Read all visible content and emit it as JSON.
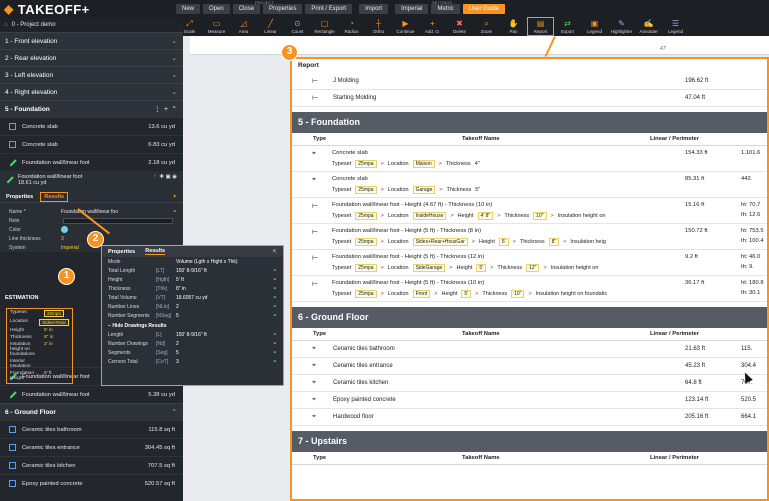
{
  "app": {
    "name": "TAKEOFF+"
  },
  "menu": {
    "project_label": "PROJECT",
    "settings_label": "SETTINGS",
    "buttons": [
      "New",
      "Open",
      "Close",
      "Properties",
      "Print / Export",
      "Import",
      "Imperial",
      "Metric",
      "User Guide"
    ]
  },
  "tools": [
    {
      "label": "Scale",
      "icon": "scale-icon"
    },
    {
      "label": "Measure",
      "icon": "measure-icon"
    },
    {
      "label": "Area",
      "icon": "area-icon"
    },
    {
      "label": "Linear",
      "icon": "linear-icon"
    },
    {
      "label": "Count",
      "icon": "count-icon"
    },
    {
      "label": "Rectangle",
      "icon": "rectangle-icon"
    },
    {
      "label": "Radius",
      "icon": "radius-icon"
    },
    {
      "label": "Ortho",
      "icon": "ortho-icon"
    },
    {
      "label": "Continue",
      "icon": "continue-icon"
    },
    {
      "label": "Add. O.",
      "icon": "add-icon"
    },
    {
      "label": "Delete",
      "icon": "delete-icon"
    },
    {
      "label": "Zoom",
      "icon": "zoom-icon"
    },
    {
      "label": "Pan",
      "icon": "pan-icon"
    },
    {
      "label": "Report",
      "icon": "report-icon"
    },
    {
      "label": "Export",
      "icon": "export-icon"
    },
    {
      "label": "Legend",
      "icon": "legend-icon"
    },
    {
      "label": "Highlighter",
      "icon": "highlighter-icon"
    },
    {
      "label": "Annotate",
      "icon": "annotate-icon"
    },
    {
      "label": "Legend",
      "icon": "legend-icon"
    }
  ],
  "sidebar": {
    "project": "0 - Project demo",
    "sections": [
      {
        "label": "1 - Front elevation"
      },
      {
        "label": "2 - Rear elevation"
      },
      {
        "label": "3 - Left elevation"
      },
      {
        "label": "4 - Right elevation"
      }
    ],
    "foundation": {
      "label": "5 - Foundation",
      "items": [
        {
          "name": "Concrete slab",
          "value": "13.6 cu yd"
        },
        {
          "name": "Concrete slab",
          "value": "6.83 cu yd"
        },
        {
          "name": "Foundation wall/linear foot",
          "value": "2.18 cu yd"
        }
      ],
      "selected": {
        "name": "Foundation wall/linear foot",
        "value": "18.61 cu yd"
      }
    },
    "tabs": {
      "properties": "Properties",
      "results": "Results"
    },
    "props": [
      {
        "k": "Name *",
        "v": "Foundation wall/linear foo"
      },
      {
        "k": "Note",
        "v": ""
      },
      {
        "k": "Color",
        "v": ""
      },
      {
        "k": "Line thickness",
        "v": "3"
      },
      {
        "k": "System",
        "v": "Imperial"
      }
    ],
    "estimation": {
      "title": "ESTIMATION",
      "rows": [
        {
          "k": "Typeset",
          "v": "25mpa"
        },
        {
          "k": "Location",
          "v": "Sides+Rear"
        },
        {
          "k": "Height",
          "v": "5' in"
        },
        {
          "k": "Thickness",
          "v": "8\" in"
        },
        {
          "k": "Insulation height on foundations",
          "v": "2' in"
        },
        {
          "k": "Interior Insulation",
          "v": ""
        },
        {
          "k": "Foundation Height",
          "v": "5' ft"
        }
      ]
    },
    "after": [
      {
        "name": "Foundation wall/linear foot",
        "value": ""
      },
      {
        "name": "Foundation wall/linear foot",
        "value": "5.38 cu yd"
      }
    ],
    "ground": {
      "label": "6 - Ground Floor",
      "items": [
        {
          "name": "Ceramic tiles bathroom",
          "value": "115.8 sq ft"
        },
        {
          "name": "Ceramic tiles entrance",
          "value": "304.45 sq ft"
        },
        {
          "name": "Ceramic tiles kitchen",
          "value": "707.5 sq ft"
        },
        {
          "name": "Epoxy painted concrete",
          "value": "520.57 sq ft"
        }
      ]
    }
  },
  "popup": {
    "tabs": [
      "Properties",
      "Results"
    ],
    "rows": [
      {
        "k": "Mode",
        "u": "",
        "v": "Volume (Lgth x Hight x Thk)"
      },
      {
        "k": "Total Length",
        "u": "[LT]",
        "v": "150' 8-9/16\" ft"
      },
      {
        "k": "Height",
        "u": "[Hgth]",
        "v": "5' ft"
      },
      {
        "k": "Thickness",
        "u": "[Thk]",
        "v": "8\" in"
      },
      {
        "k": "Total Volume",
        "u": "[VT]",
        "v": "18.6057 cu yd"
      },
      {
        "k": "Number Lines",
        "u": "[NLin]",
        "v": "2"
      },
      {
        "k": "Number Segments",
        "u": "[NSeg]",
        "v": "5"
      }
    ],
    "sub": "Hide Drawings Results",
    "rows2": [
      {
        "k": "Length",
        "u": "[L]",
        "v": "150' 8-9/16\" ft"
      },
      {
        "k": "Number Drawings",
        "u": "[Nd]",
        "v": "2"
      },
      {
        "k": "Segments",
        "u": "[Seg]",
        "v": "5"
      },
      {
        "k": "Corners Total",
        "u": "[CoT]",
        "v": "3"
      }
    ]
  },
  "ruler": {
    "label": "47'"
  },
  "report": {
    "title": "Report",
    "top_rows": [
      {
        "name": "J Molding",
        "linear": "196.62 ft",
        "ext": ""
      },
      {
        "name": "Starting Molding",
        "linear": "47.04 ft",
        "ext": ""
      }
    ],
    "headers": {
      "type": "Type",
      "name": "Takeoff Name",
      "linear": "Linear / Perimeter"
    },
    "foundation": {
      "title": "5 - Foundation",
      "rows": [
        {
          "name": "Concrete slab",
          "path": [
            "Typeset",
            "25mpa",
            "Location",
            "Maison",
            "Thickness",
            "4\""
          ],
          "linear": "154.33 ft",
          "ext": "1,101.6",
          "ext2": ""
        },
        {
          "name": "Concrete slab",
          "path": [
            "Typeset",
            "25mpa",
            "Location",
            "Garage",
            "Thickness",
            "5\""
          ],
          "linear": "85.31 ft",
          "ext": "442.",
          "ext2": ""
        },
        {
          "name": "Foundation wall/linear foot - Height (4.67 ft) - Thickness (10 in)",
          "path": [
            "Typeset",
            "25mpa",
            "Location",
            "InsideHouse",
            "Height",
            "4' 8\"",
            "Thickness",
            "10\"",
            "Insulation height on"
          ],
          "linear": "15.16 ft",
          "ext": "ht: 70.7",
          "ext2": "th: 12.6"
        },
        {
          "name": "Foundation wall/linear foot - Height (5 ft) - Thickness (8 in)",
          "path": [
            "Typeset",
            "25mpa",
            "Location",
            "Sides+Rear+HousGar",
            "Height",
            "5'",
            "Thickness",
            "8\"",
            "Insulation heig"
          ],
          "linear": "150.72 ft",
          "ext": "ht: 753.5",
          "ext2": "th: 100.4"
        },
        {
          "name": "Foundation wall/linear foot - Height (5 ft) - Thickness (12 in)",
          "path": [
            "Typeset",
            "25mpa",
            "Location",
            "SideGarage",
            "Height",
            "5'",
            "Thickness",
            "12\"",
            "Insulation height on"
          ],
          "linear": "9.2 ft",
          "ext": "ht: 46.0",
          "ext2": "th: 9."
        },
        {
          "name": "Foundation wall/linear foot - Height (5 ft) - Thickness (10 in)",
          "path": [
            "Typeset",
            "25mpa",
            "Location",
            "Front",
            "Height",
            "5'",
            "Thickness",
            "10\"",
            "Insulation height on foundatic"
          ],
          "linear": "36.17 ft",
          "ext": "ht: 180.8",
          "ext2": "th: 30.1"
        }
      ]
    },
    "ground": {
      "title": "6 - Ground Floor",
      "rows": [
        {
          "name": "Ceramic tiles bathroom",
          "linear": "21.63 ft",
          "ext": "115."
        },
        {
          "name": "Ceramic tiles entrance",
          "linear": "45.23 ft",
          "ext": "304.4"
        },
        {
          "name": "Ceramic tiles kitchen",
          "linear": "64.8 ft",
          "ext": "707."
        },
        {
          "name": "Epoxy painted concrete",
          "linear": "123.14 ft",
          "ext": "520.5"
        },
        {
          "name": "Hardwood floor",
          "linear": "205.16 ft",
          "ext": "664.1"
        }
      ]
    },
    "upstairs": {
      "title": "7 - Upstairs"
    }
  },
  "callouts": [
    "1",
    "2",
    "3"
  ],
  "colors": {
    "accent": "#f7931e",
    "chip_bg": "#fffbe0",
    "sidebar_bg": "#23272d",
    "section_bar": "#555c66"
  }
}
